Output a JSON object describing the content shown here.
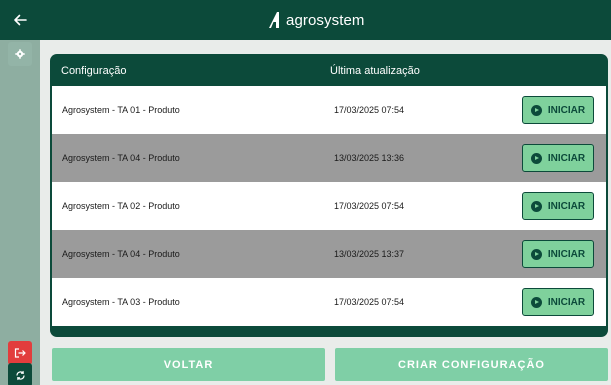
{
  "header": {
    "brand_name": "agrosystem",
    "back_icon": "arrow-left-icon"
  },
  "sidebar": {
    "settings_icon": "gear-icon",
    "logout_icon": "logout-icon",
    "sync_icon": "sync-icon"
  },
  "table": {
    "col_config": "Configuração",
    "col_updated": "Última atualização",
    "start_label": "INICIAR",
    "rows": [
      {
        "name": "Agrosystem - TA 01 - Produto",
        "updated": "17/03/2025 07:54"
      },
      {
        "name": "Agrosystem - TA 04 - Produto",
        "updated": "13/03/2025 13:36"
      },
      {
        "name": "Agrosystem - TA 02 - Produto",
        "updated": "17/03/2025 07:54"
      },
      {
        "name": "Agrosystem - TA 04 - Produto",
        "updated": "13/03/2025 13:37"
      },
      {
        "name": "Agrosystem - TA 03 - Produto",
        "updated": "17/03/2025 07:54"
      }
    ]
  },
  "footer": {
    "back_label": "VOLTAR",
    "create_label": "CRIAR CONFIGURAÇÃO"
  },
  "colors": {
    "primary": "#0c4a3a",
    "accent": "#7fd19c",
    "danger": "#e23d3d",
    "row_alt": "#9b9b9b"
  }
}
